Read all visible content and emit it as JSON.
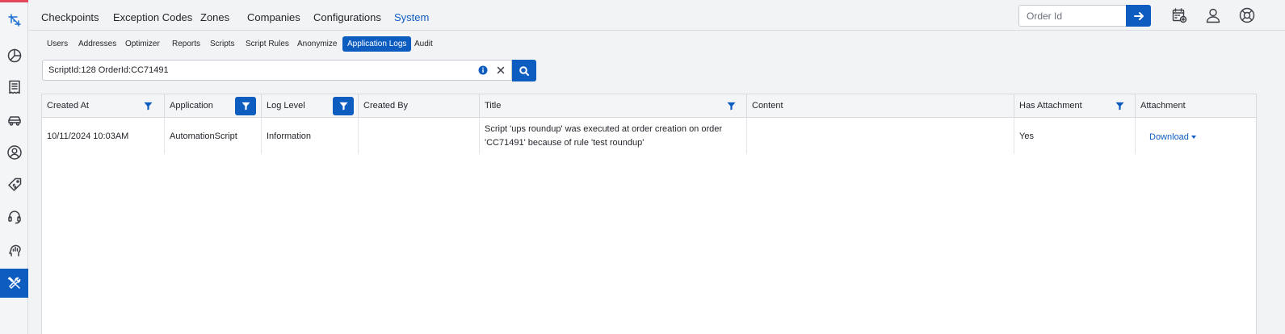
{
  "nav": {
    "tabs": [
      "Checkpoints",
      "Exception Codes",
      "Zones",
      "Companies",
      "Configurations",
      "System"
    ],
    "active_tab": "System"
  },
  "order_search": {
    "placeholder": "Order Id"
  },
  "sidebar": {
    "items": [
      "logo-icon",
      "dashboard-icon",
      "orders-icon",
      "vehicle-icon",
      "user-icon",
      "pricing-icon",
      "support-icon",
      "analytics-icon",
      "tools-icon"
    ],
    "active": "tools-icon"
  },
  "subnav": {
    "tabs": [
      "Users",
      "Addresses",
      "Optimizer",
      "Reports",
      "Scripts",
      "Script Rules",
      "Anonymize",
      "Application Logs",
      "Audit"
    ],
    "active_tab": "Application Logs"
  },
  "search": {
    "query": "ScriptId:128 OrderId:CC71491"
  },
  "table": {
    "columns": [
      "Created At",
      "Application",
      "Log Level",
      "Created By",
      "Title",
      "Content",
      "Has Attachment",
      "Attachment"
    ],
    "rows": [
      {
        "created_at": "10/11/2024 10:03AM",
        "application": "AutomationScript",
        "log_level": "Information",
        "created_by": "",
        "title": "Script 'ups roundup' was executed at order creation on order 'CC71491' because of rule 'test roundup'",
        "content": "",
        "has_attachment": "Yes",
        "attachment": "Download"
      }
    ]
  },
  "colors": {
    "accent": "#0d5cc0",
    "brand_stripe": "#e2475b"
  }
}
